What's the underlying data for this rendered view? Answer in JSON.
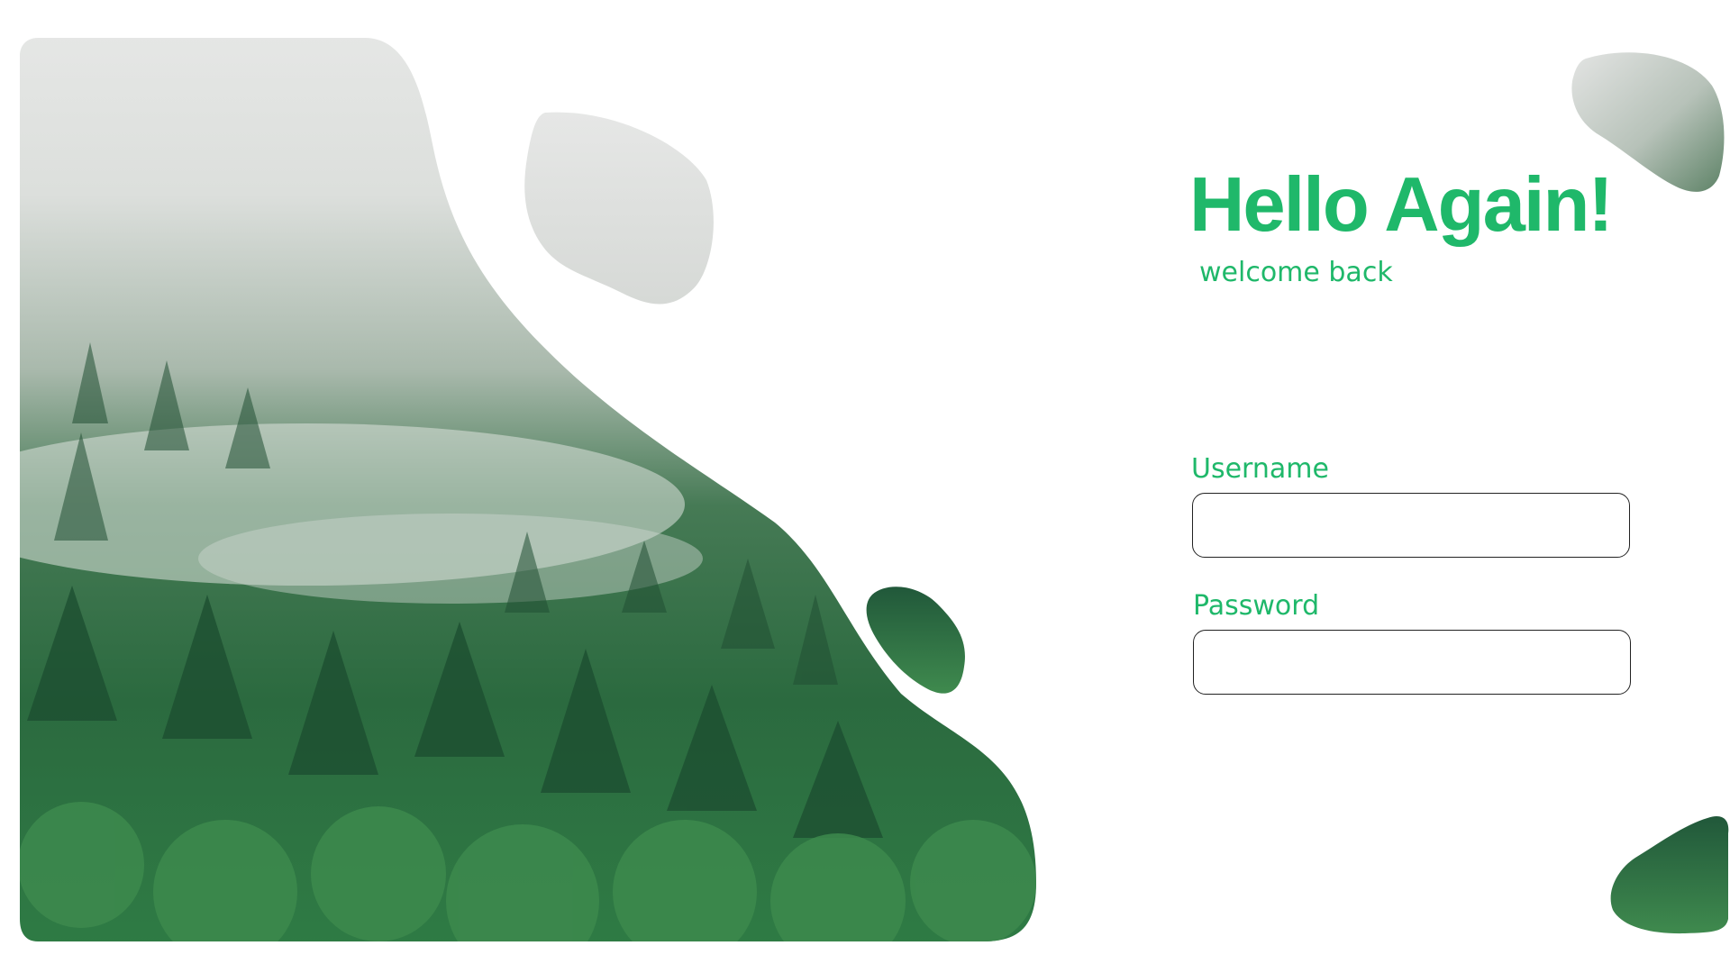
{
  "login": {
    "title": "Hello Again!",
    "subtitle": "welcome back",
    "username_label": "Username",
    "username_value": "",
    "password_label": "Password",
    "password_value": ""
  },
  "colors": {
    "accent": "#1fb86a",
    "forest_dark": "#1f5a36",
    "forest_mid": "#2f7a48",
    "fog": "#e6e8e6",
    "input_border": "#222222"
  }
}
